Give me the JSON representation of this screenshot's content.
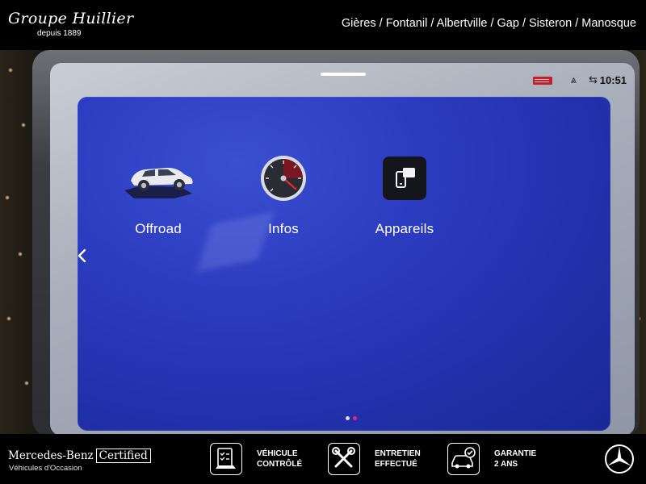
{
  "header": {
    "brand_name": "Groupe Huillier",
    "brand_since": "depuis 1889",
    "locations": "Gières / Fontanil / Albertville / Gap / Sisteron / Manosque"
  },
  "screen": {
    "status_bar": {
      "time": "10:51",
      "icons": [
        "sos-warning-icon",
        "signal-icon",
        "connectivity-icon"
      ]
    },
    "menu": {
      "items": [
        {
          "label": "Offroad",
          "icon": "offroad-car-icon"
        },
        {
          "label": "Infos",
          "icon": "gauge-icon"
        },
        {
          "label": "Appareils",
          "icon": "devices-icon"
        }
      ],
      "page_dots": {
        "count": 2,
        "active": 2
      },
      "accent_color": "#e22873",
      "panel_color": "#2c3cc0"
    }
  },
  "footer": {
    "mb_name": "Mercedes-Benz",
    "mb_certified": "Certified",
    "mb_subtitle": "Véhicules d'Occasion",
    "badges": [
      {
        "line1": "VÉHICULE",
        "line2": "CONTRÔLÉ",
        "icon": "checklist-car-icon"
      },
      {
        "line1": "ENTRETIEN",
        "line2": "EFFECTUÉ",
        "icon": "tools-icon"
      },
      {
        "line1": "GARANTIE",
        "line2": "2 ANS",
        "icon": "car-check-icon"
      }
    ]
  }
}
